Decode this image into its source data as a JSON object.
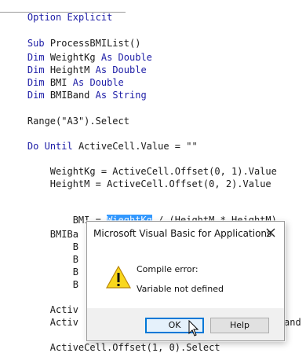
{
  "code_lines": [
    "Option Explicit",
    "",
    "Sub ProcessBMIList()",
    "",
    "    Dim WeightKg As Double",
    "    Dim HeightM As Double",
    "    Dim BMI As Double",
    "    Dim BMIBand As String",
    "",
    "    Range(\"A3\").Select",
    "",
    "    Do Until ActiveCell.Value = \"\"",
    "",
    "        WeightKg = ActiveCell.Offset(0, 1).Value",
    "        HeightM = ActiveCell.Offset(0, 2).Value",
    "",
    "        BMI = WieghtKg / (HeightM * HeightM)",
    "",
    "        BMIBa",
    "            B",
    "            B",
    "            B",
    "            B",
    "",
    "        Activ",
    "        Activ",
    "",
    "        ActiveCell.Offset(1, 0).Select"
  ],
  "partial_text": {
    "line25_tail": "and"
  },
  "bmi_line": {
    "prefix": "        BMI = ",
    "selected": "WieghtKg",
    "suffix": " / (HeightM * HeightM)"
  },
  "dialog": {
    "title": "Microsoft Visual Basic for Applications",
    "message_line1": "Compile error:",
    "message_line2": "Variable not defined",
    "ok_label": "OK",
    "help_label": "Help"
  },
  "icons": {
    "close": "close-icon",
    "warning": "warning-icon",
    "cursor": "mouse-pointer-icon"
  },
  "colors": {
    "keyword": "#1c1ca6",
    "selection": "#3399ff",
    "dialog_bg": "#f0f0f0"
  }
}
